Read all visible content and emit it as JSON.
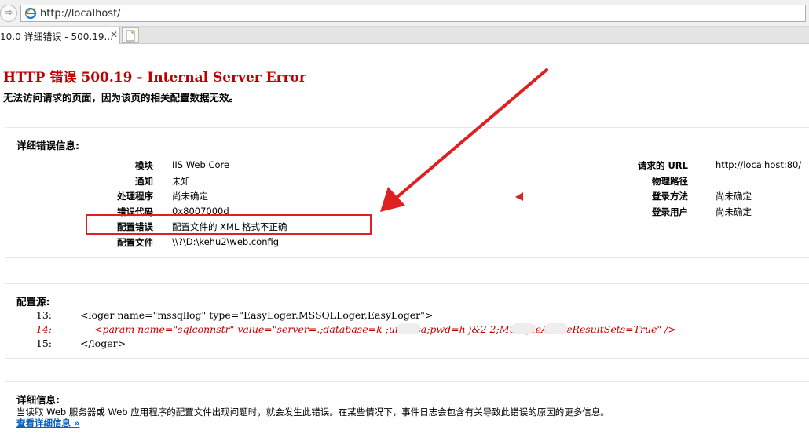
{
  "browser": {
    "url": "http://localhost/",
    "tab_title": "10.0 详细错误 - 500.19...",
    "tab_close": "✕",
    "back_glyph": "⇨"
  },
  "page": {
    "title": "HTTP 错误 500.19 - Internal Server Error",
    "subtitle": "无法访问请求的页面，因为该页的相关配置数据无效。"
  },
  "detail": {
    "heading": "详细错误信息:",
    "left": [
      {
        "label": "模块",
        "value": "IIS Web Core"
      },
      {
        "label": "通知",
        "value": "未知"
      },
      {
        "label": "处理程序",
        "value": "尚未确定"
      },
      {
        "label": "错误代码",
        "value": "0x8007000d"
      },
      {
        "label": "配置错误",
        "value": "配置文件的 XML 格式不正确"
      },
      {
        "label": "配置文件",
        "value": "\\\\?\\D:\\kehu2\\web.config"
      }
    ],
    "right": [
      {
        "label": "请求的 URL",
        "value": "http://localhost:80/"
      },
      {
        "label": "物理路径",
        "value": ""
      },
      {
        "label": "登录方法",
        "value": "尚未确定"
      },
      {
        "label": "登录用户",
        "value": "尚未确定"
      }
    ]
  },
  "config_source": {
    "heading": "配置源:",
    "lines": [
      {
        "num": "13:",
        "code": "<loger name=\"mssqllog\" type=\"EasyLoger.MSSQLLoger,EasyLoger\">",
        "highlight": false
      },
      {
        "num": "14:",
        "code": "<param name=\"sqlconnstr\" value=\"server=.;database=k    ;uid= sa;pwd=h  j&2      2;MultipleActiveResultSets=True\" />",
        "highlight": true
      },
      {
        "num": "15:",
        "code": "</loger>",
        "highlight": false
      }
    ]
  },
  "more_info": {
    "heading": "详细信息:",
    "text": "当读取 Web 服务器或 Web 应用程序的配置文件出现问题时，就会发生此错误。在某些情况下，事件日志会包含有关导致此错误的原因的更多信息。",
    "link": "查看详细信息 »"
  },
  "colors": {
    "error_red": "#c00000",
    "annotation_red": "#e02020",
    "link_blue": "#0b5fbf"
  }
}
